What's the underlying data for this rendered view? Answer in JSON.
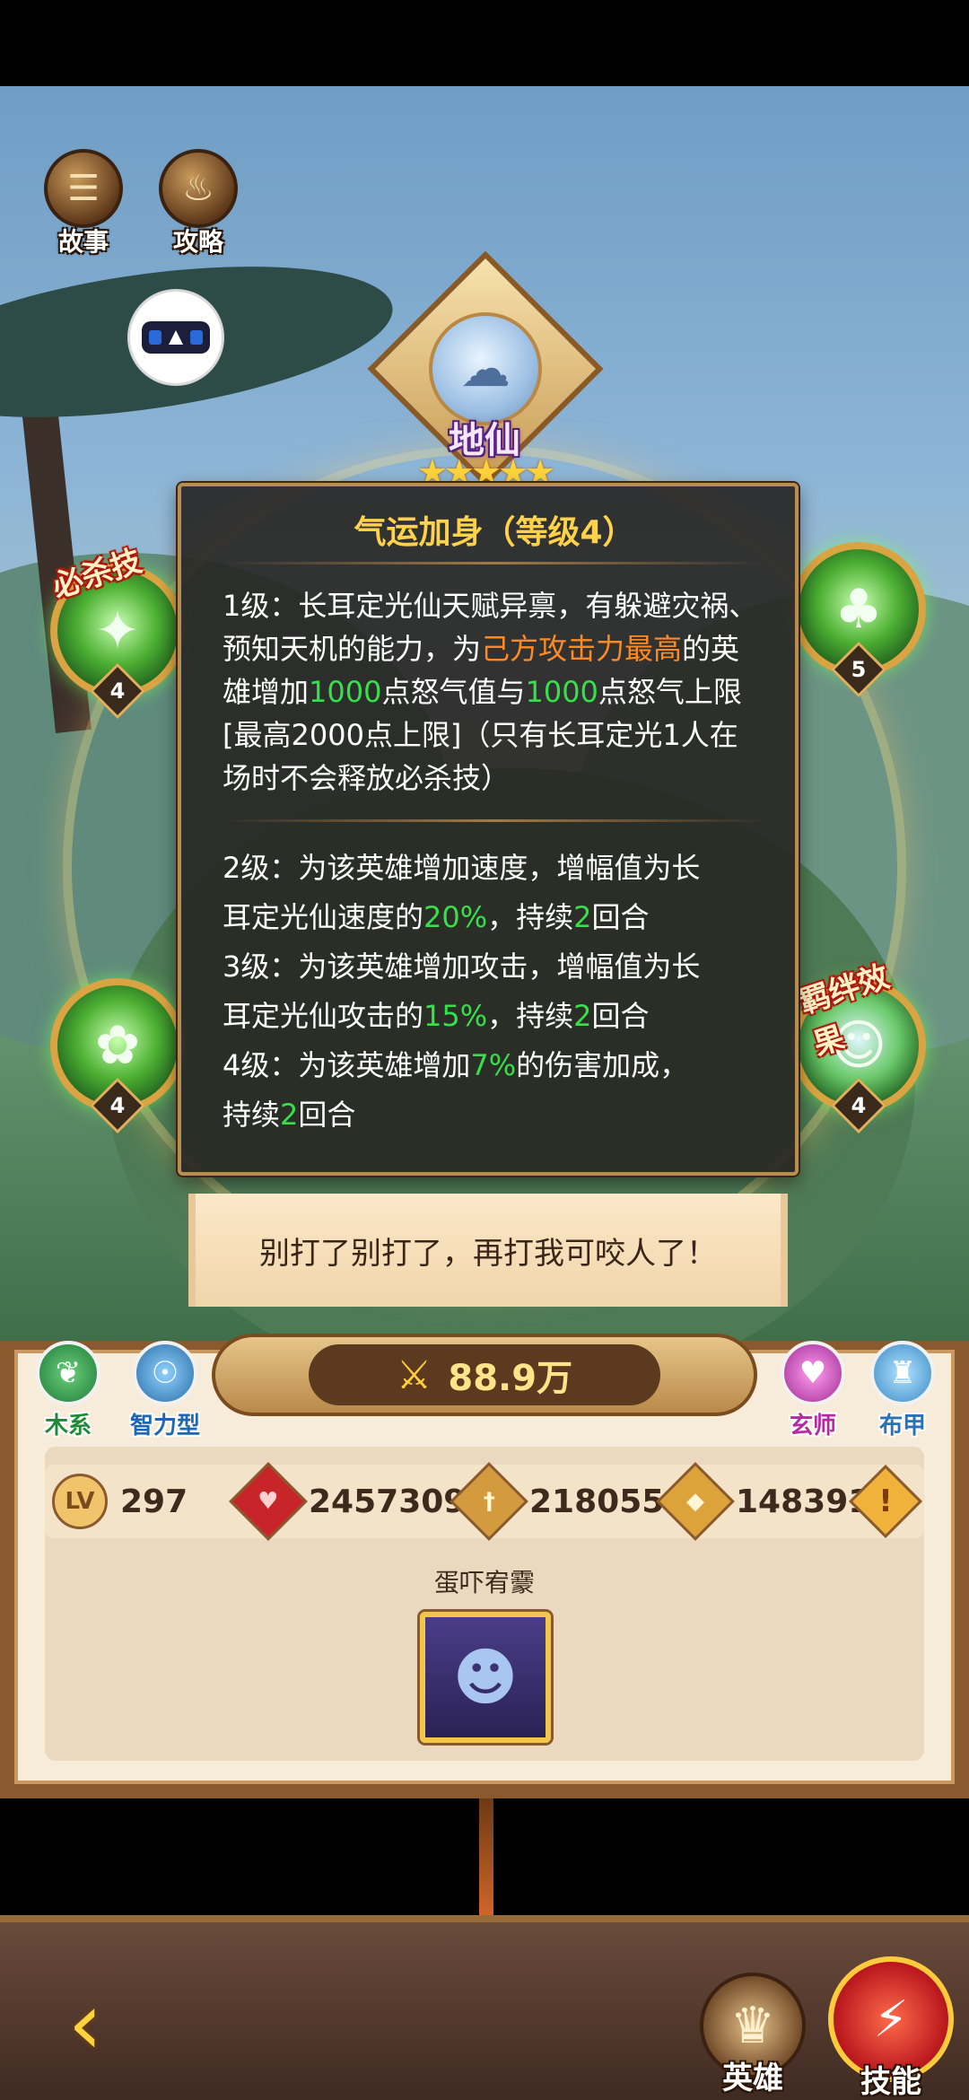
{
  "top_buttons": {
    "story": {
      "label": "故事",
      "icon": "scroll-icon"
    },
    "guide": {
      "label": "攻略",
      "icon": "flame-icon"
    }
  },
  "vr_toggle": {
    "icon": "vr-glasses-icon"
  },
  "hero": {
    "element": "地仙",
    "stars": 5,
    "stars_text": "★★★★★"
  },
  "skills": {
    "ultimate": {
      "tag": "必杀技",
      "level": "4"
    },
    "talent": {
      "level": "5"
    },
    "passive": {
      "level": "4"
    },
    "bond": {
      "tag": "羁绊效果",
      "level": "4"
    }
  },
  "tooltip": {
    "title": "气运加身（等级4）",
    "lv1": {
      "p1": "1级：长耳定光仙天赋异禀，有躲避灾祸、预知天机的能力，为",
      "h1": "己方攻击力最高",
      "p2": "的英雄增加",
      "h2": "1000",
      "p3": "点怒气值与",
      "h3": "1000",
      "p4": "点怒气上限[最高2000点上限]（只有长耳定光1人在场时不会释放必杀技）"
    },
    "lv2": {
      "p1": "2级：为该英雄增加速度，增幅值为长",
      "p2": "耳定光仙速度的",
      "h1": "20%",
      "p3": "，持续",
      "h2": "2",
      "p4": "回合"
    },
    "lv3": {
      "p1": "3级：为该英雄增加攻击，增幅值为长",
      "p2": "耳定光仙攻击的",
      "h1": "15%",
      "p3": "，持续",
      "h2": "2",
      "p4": "回合"
    },
    "lv4": {
      "p1": "4级：为该英雄增加",
      "h1": "7%",
      "p2": "的伤害加成，",
      "p3": "持续",
      "h2": "2",
      "p4": "回合"
    }
  },
  "speech": "别打了别打了，再打我可咬人了！",
  "power": {
    "icon": "crossed-swords-icon",
    "value": "88.9万"
  },
  "traits": {
    "wood": {
      "label": "木系",
      "icon": "leaf-icon"
    },
    "intelligence": {
      "label": "智力型",
      "icon": "brain-icon"
    },
    "mystic": {
      "label": "玄师",
      "icon": "heart-orb-icon"
    },
    "cloth": {
      "label": "布甲",
      "icon": "robe-icon"
    }
  },
  "stats": {
    "level": {
      "badge": "LV",
      "value": "297"
    },
    "hp": {
      "value": "2457309"
    },
    "attack": {
      "value": "218055"
    },
    "defense": {
      "value": "148391"
    }
  },
  "equipment": {
    "label": "蛋吓宥靀"
  },
  "nav": {
    "hero": "英雄",
    "skill": "技能"
  },
  "colors": {
    "highlight_orange": "#ff8a24",
    "highlight_green": "#35e04a",
    "title_gold": "#ffd24a"
  }
}
